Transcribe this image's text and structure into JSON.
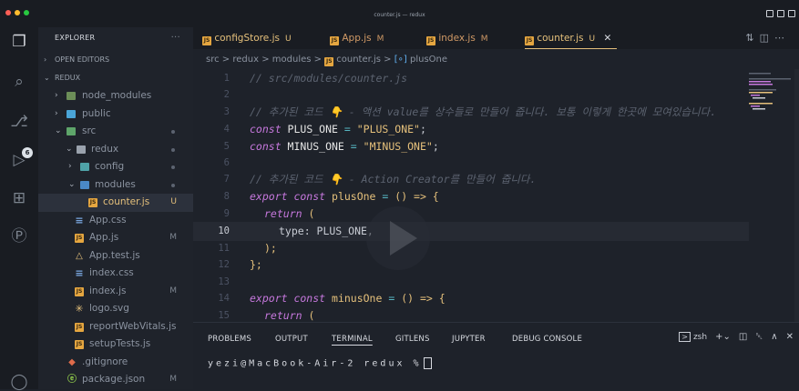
{
  "window": {
    "title": "counter.js — redux"
  },
  "sidebar": {
    "header": "EXPLORER",
    "more": "···",
    "open_editors": "OPEN EDITORS",
    "root": "REDUX",
    "items": [
      {
        "label": "node_modules",
        "status": ""
      },
      {
        "label": "public",
        "status": ""
      },
      {
        "label": "src",
        "status": ""
      },
      {
        "label": "redux",
        "status": ""
      },
      {
        "label": "config",
        "status": ""
      },
      {
        "label": "modules",
        "status": ""
      },
      {
        "label": "counter.js",
        "status": "U"
      },
      {
        "label": "App.css",
        "status": ""
      },
      {
        "label": "App.js",
        "status": "M"
      },
      {
        "label": "App.test.js",
        "status": ""
      },
      {
        "label": "index.css",
        "status": ""
      },
      {
        "label": "index.js",
        "status": "M"
      },
      {
        "label": "logo.svg",
        "status": ""
      },
      {
        "label": "reportWebVitals.js",
        "status": ""
      },
      {
        "label": "setupTests.js",
        "status": ""
      },
      {
        "label": ".gitignore",
        "status": ""
      },
      {
        "label": "package.json",
        "status": "M"
      }
    ],
    "scm_badge": "6"
  },
  "tabs": [
    {
      "label": "configStore.js",
      "status": "U"
    },
    {
      "label": "App.js",
      "status": "M"
    },
    {
      "label": "index.js",
      "status": "M"
    },
    {
      "label": "counter.js",
      "status": "U",
      "close": "✕"
    }
  ],
  "breadcrumb": {
    "parts": [
      "src",
      "redux",
      "modules",
      "counter.js",
      "plusOne"
    ],
    "sep": ">"
  },
  "editor": {
    "line_numbers": [
      "1",
      "2",
      "3",
      "4",
      "5",
      "6",
      "7",
      "8",
      "9",
      "10",
      "11",
      "12",
      "13",
      "14",
      "15"
    ],
    "code": {
      "l1": "// src/modules/counter.js",
      "l3": "// 추가된 코드 👇 - 액션 value를 상수들로 만들어 줍니다. 보통 이렇게 한곳에 모여있습니다.",
      "l4_kw": "const",
      "l4_var": " PLUS_ONE ",
      "l4_op": "=",
      "l4_str": " \"PLUS_ONE\"",
      "l4_end": ";",
      "l5_kw": "const",
      "l5_var": " MINUS_ONE ",
      "l5_op": "=",
      "l5_str": " \"MINUS_ONE\"",
      "l5_end": ";",
      "l7": "// 추가된 코드 👇 - Action Creator를 만들어 줍니다.",
      "l8_kw": "export const",
      "l8_fn": " plusOne ",
      "l8_op": "=",
      "l8_rest": " () => {",
      "l9_kw": "return",
      "l9_br": " (",
      "l10": "type: PLUS_ONE,",
      "l11": ");",
      "l12": "};",
      "l14_kw": "export const",
      "l14_fn": " minusOne ",
      "l14_op": "=",
      "l14_rest": " () => {",
      "l15_kw": "return",
      "l15_br": " ("
    }
  },
  "panel": {
    "tabs": [
      "PROBLEMS",
      "OUTPUT",
      "TERMINAL",
      "GITLENS",
      "JUPYTER",
      "DEBUG CONSOLE"
    ],
    "shell": "zsh",
    "prompt": "yezi@MacBook-Air-2 redux %"
  },
  "colors": {
    "accent": "#e5c07b",
    "keyword": "#c678dd",
    "comment": "#5c6370"
  }
}
